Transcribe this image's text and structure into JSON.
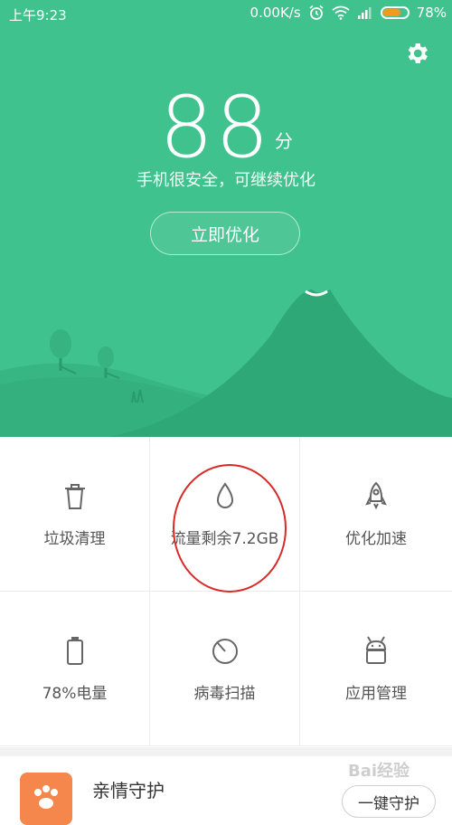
{
  "status_bar": {
    "time": "上午9:23",
    "net_speed": "0.00K/s",
    "battery_percent": "78%",
    "battery_level": 0.78,
    "icons": [
      "alarm-icon",
      "wifi-icon",
      "signal-icon",
      "battery-icon"
    ]
  },
  "header": {
    "score": "88",
    "score_unit": "分",
    "status_text": "手机很安全，可继续优化",
    "optimize_label": "立即优化",
    "settings_icon": "gear-icon"
  },
  "grid": {
    "items": [
      {
        "label": "垃圾清理",
        "icon": "trash-icon"
      },
      {
        "label": "流量剩余7.2GB",
        "icon": "drop-icon"
      },
      {
        "label": "优化加速",
        "icon": "rocket-icon"
      },
      {
        "label": "78%电量",
        "icon": "battery-icon"
      },
      {
        "label": "病毒扫描",
        "icon": "scan-icon"
      },
      {
        "label": "应用管理",
        "icon": "android-icon"
      }
    ]
  },
  "family_card": {
    "title": "亲情守护",
    "button_label": "一键守护"
  },
  "colors": {
    "hero_green": "#3fc28e",
    "accent_orange": "#f5864c",
    "annotation_red": "#d92a2a"
  },
  "watermark": "Bai经验"
}
